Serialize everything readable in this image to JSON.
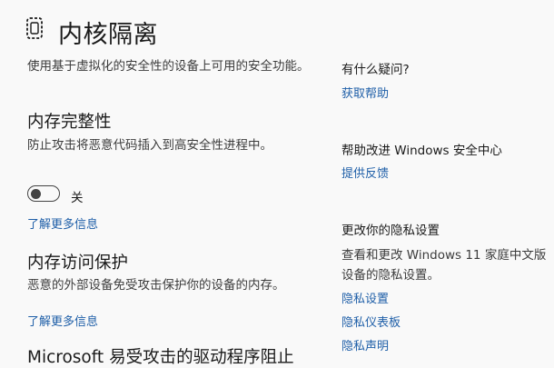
{
  "page": {
    "title": "内核隔离",
    "title_icon": "chip-shield-icon",
    "description": "使用基于虚拟化的安全性的设备上可用的安全功能。"
  },
  "memory_integrity": {
    "heading": "内存完整性",
    "description": "防止攻击将恶意代码插入到高安全性进程中。",
    "toggle_state": "off",
    "toggle_label": "关",
    "learn_more": "了解更多信息"
  },
  "memory_access_protection": {
    "heading": "内存访问保护",
    "description": "恶意的外部设备免受攻击保护你的设备的内存。",
    "learn_more": "了解更多信息"
  },
  "driver_blocklist": {
    "heading": "Microsoft 易受攻击的驱动程序阻止"
  },
  "sidebar": {
    "questions_heading": "有什么疑问?",
    "get_help": "获取帮助",
    "improve_heading": "帮助改进 Windows 安全中心",
    "feedback": "提供反馈",
    "privacy_heading": "更改你的隐私设置",
    "privacy_text": "查看和更改 Windows 11 家庭中文版设备的隐私设置。",
    "privacy_settings": "隐私设置",
    "privacy_dashboard": "隐私仪表板",
    "privacy_statement": "隐私声明"
  },
  "colors": {
    "background": "#f9f9f9",
    "link": "#1f5fa8",
    "text": "#1a1a1a",
    "secondary_text": "#3c3c3c"
  }
}
